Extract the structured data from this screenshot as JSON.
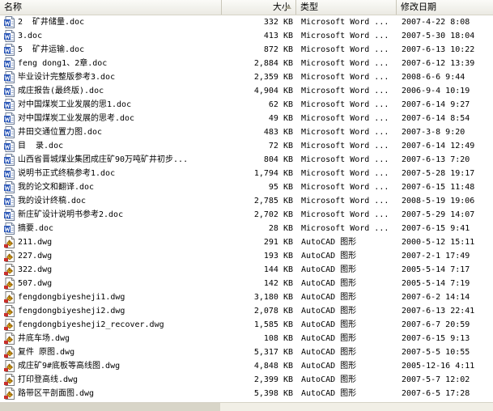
{
  "columns": {
    "name": "名称",
    "size": "大小",
    "type": "类型",
    "date": "修改日期"
  },
  "files": [
    {
      "name": "2  矿井储量.doc",
      "size": "332 KB",
      "type": "Microsoft Word ...",
      "date": "2007-4-22 8:08",
      "icon": "word-doc-icon"
    },
    {
      "name": "3.doc",
      "size": "413 KB",
      "type": "Microsoft Word ...",
      "date": "2007-5-30 18:04",
      "icon": "word-doc-icon"
    },
    {
      "name": "5  矿井运输.doc",
      "size": "872 KB",
      "type": "Microsoft Word ...",
      "date": "2007-6-13 10:22",
      "icon": "word-doc-icon"
    },
    {
      "name": "feng dong1、2章.doc",
      "size": "2,884 KB",
      "type": "Microsoft Word ...",
      "date": "2007-6-12 13:39",
      "icon": "word-doc-icon"
    },
    {
      "name": "毕业设计完整版参考3.doc",
      "size": "2,359 KB",
      "type": "Microsoft Word ...",
      "date": "2008-6-6 9:44",
      "icon": "word-doc-icon"
    },
    {
      "name": "成庄报告(最终版).doc",
      "size": "4,904 KB",
      "type": "Microsoft Word ...",
      "date": "2006-9-4 10:19",
      "icon": "word-doc-icon"
    },
    {
      "name": "对中国煤炭工业发展的思1.doc",
      "size": "62 KB",
      "type": "Microsoft Word ...",
      "date": "2007-6-14 9:27",
      "icon": "word-doc-icon"
    },
    {
      "name": "对中国煤炭工业发展的思考.doc",
      "size": "49 KB",
      "type": "Microsoft Word ...",
      "date": "2007-6-14 8:54",
      "icon": "word-doc-icon"
    },
    {
      "name": "井田交通位置力图.doc",
      "size": "483 KB",
      "type": "Microsoft Word ...",
      "date": "2007-3-8 9:20",
      "icon": "word-doc-icon"
    },
    {
      "name": "目  录.doc",
      "size": "72 KB",
      "type": "Microsoft Word ...",
      "date": "2007-6-14 12:49",
      "icon": "word-doc-icon"
    },
    {
      "name": "山西省晋城煤业集团成庄矿90万吨矿井初步...",
      "size": "804 KB",
      "type": "Microsoft Word ...",
      "date": "2007-6-13 7:20",
      "icon": "word-doc-icon"
    },
    {
      "name": "说明书正式终稿参考1.doc",
      "size": "1,794 KB",
      "type": "Microsoft Word ...",
      "date": "2007-5-28 19:17",
      "icon": "word-doc-icon"
    },
    {
      "name": "我的论文和翻译.doc",
      "size": "95 KB",
      "type": "Microsoft Word ...",
      "date": "2007-6-15 11:48",
      "icon": "word-doc-icon"
    },
    {
      "name": "我的设计终稿.doc",
      "size": "2,785 KB",
      "type": "Microsoft Word ...",
      "date": "2008-5-19 19:06",
      "icon": "word-doc-icon"
    },
    {
      "name": "新庄矿设计说明书参考2.doc",
      "size": "2,702 KB",
      "type": "Microsoft Word ...",
      "date": "2007-5-29 14:07",
      "icon": "word-doc-icon"
    },
    {
      "name": "摘要.doc",
      "size": "28 KB",
      "type": "Microsoft Word ...",
      "date": "2007-6-15 9:41",
      "icon": "word-doc-icon"
    },
    {
      "name": "211.dwg",
      "size": "291 KB",
      "type": "AutoCAD 图形",
      "date": "2000-5-12 15:11",
      "icon": "autocad-dwg-icon"
    },
    {
      "name": "227.dwg",
      "size": "193 KB",
      "type": "AutoCAD 图形",
      "date": "2007-2-1 17:49",
      "icon": "autocad-dwg-icon"
    },
    {
      "name": "322.dwg",
      "size": "144 KB",
      "type": "AutoCAD 图形",
      "date": "2005-5-14 7:17",
      "icon": "autocad-dwg-icon"
    },
    {
      "name": "507.dwg",
      "size": "142 KB",
      "type": "AutoCAD 图形",
      "date": "2005-5-14 7:19",
      "icon": "autocad-dwg-icon"
    },
    {
      "name": "fengdongbiyesheji1.dwg",
      "size": "3,180 KB",
      "type": "AutoCAD 图形",
      "date": "2007-6-2 14:14",
      "icon": "autocad-dwg-icon"
    },
    {
      "name": "fengdongbiyesheji2.dwg",
      "size": "2,078 KB",
      "type": "AutoCAD 图形",
      "date": "2007-6-13 22:41",
      "icon": "autocad-dwg-icon"
    },
    {
      "name": "fengdongbiyesheji2_recover.dwg",
      "size": "1,585 KB",
      "type": "AutoCAD 图形",
      "date": "2007-6-7 20:59",
      "icon": "autocad-dwg-icon"
    },
    {
      "name": "井底车场.dwg",
      "size": "108 KB",
      "type": "AutoCAD 图形",
      "date": "2007-6-15 9:13",
      "icon": "autocad-dwg-icon"
    },
    {
      "name": "复件 原图.dwg",
      "size": "5,317 KB",
      "type": "AutoCAD 图形",
      "date": "2007-5-5 10:55",
      "icon": "autocad-dwg-icon"
    },
    {
      "name": "成庄矿9#底板等高线图.dwg",
      "size": "4,848 KB",
      "type": "AutoCAD 图形",
      "date": "2005-12-16 4:11",
      "icon": "autocad-dwg-icon"
    },
    {
      "name": "打印登高线.dwg",
      "size": "2,399 KB",
      "type": "AutoCAD 图形",
      "date": "2007-5-7 12:02",
      "icon": "autocad-dwg-icon"
    },
    {
      "name": "路带区平剖面图.dwg",
      "size": "5,398 KB",
      "type": "AutoCAD 图形",
      "date": "2007-6-5 17:28",
      "icon": "autocad-dwg-icon"
    }
  ]
}
